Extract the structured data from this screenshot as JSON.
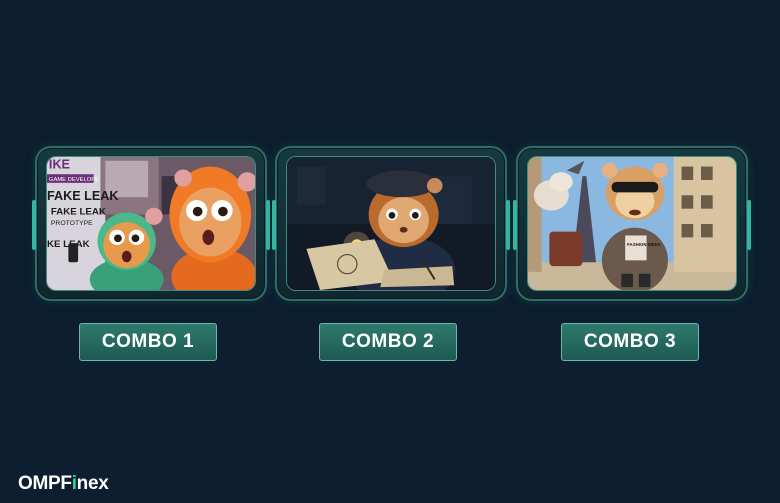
{
  "combos": [
    {
      "label": "COMBO 1",
      "image_alt": "Two shocked hamster characters in hoodies looking at a phone in front of 'FAKE LEAK PROTOTYPE' posters",
      "poster_texts": [
        "IKE",
        "GAME DEVELOPE",
        "FAKE LEAK",
        "FAKE LEAK",
        "PROTOTYPE",
        "KE LEAK"
      ]
    },
    {
      "label": "COMBO 2",
      "image_alt": "Hamster in a beret sketching a drawing by flashlight at night"
    },
    {
      "label": "COMBO 3",
      "image_alt": "Hamster in sunglasses and a coat walking in Paris near the Eiffel Tower",
      "shirt_text": "FASHION WEEK"
    }
  ],
  "brand": {
    "prefix": "OMPF",
    "highlight": "i",
    "suffix": "nex"
  },
  "colors": {
    "background": "#0c1e2f",
    "accent": "#2bd4b0",
    "button": "#2f7a6d"
  }
}
